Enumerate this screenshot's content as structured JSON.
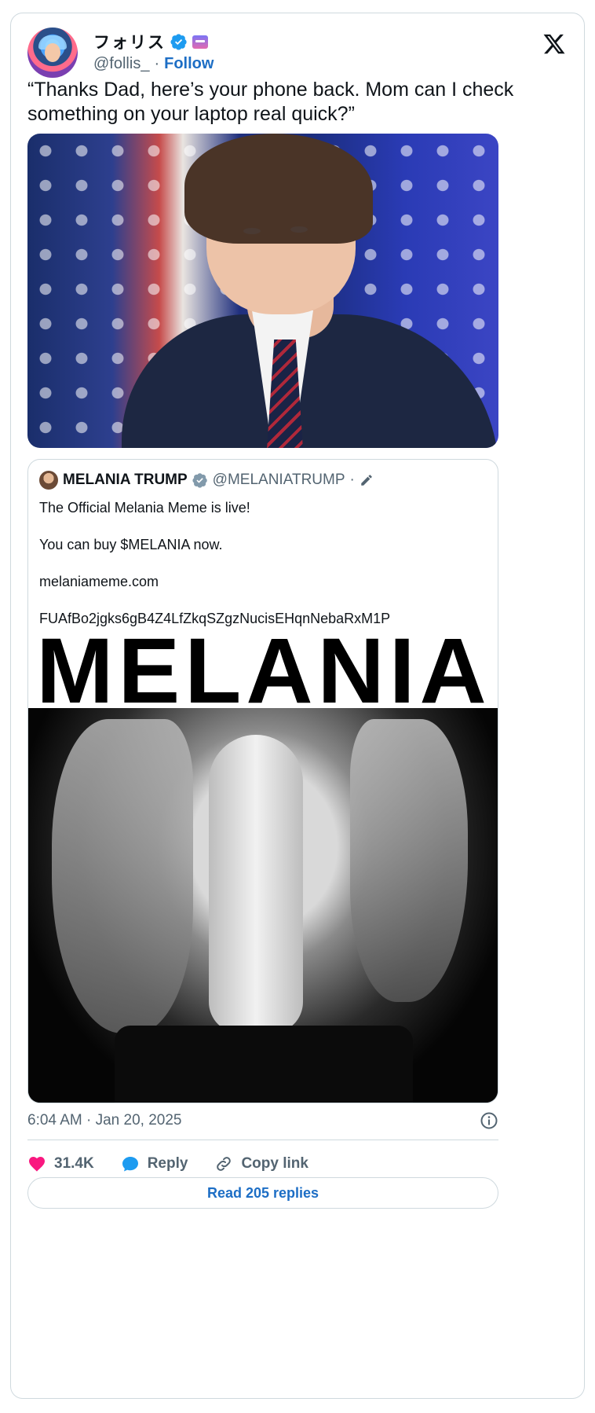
{
  "author": {
    "name": "フォリス",
    "handle": "@follis_",
    "separator": "·",
    "follow_label": "Follow"
  },
  "tweet": {
    "text": "“Thanks Dad, here’s your phone back. Mom can I check something on your laptop real quick?”",
    "timestamp": "6:04 AM · Jan 20, 2025"
  },
  "quoted": {
    "name": "MELANIA TRUMP",
    "handle": "@MELANIATRUMP",
    "separator": "·",
    "lines": [
      "The Official Melania Meme is live!",
      "You can buy $MELANIA now.",
      "melaniameme.com",
      "FUAfBo2jgks6gB4Z4LfZkqSZgzNucisEHqnNebaRxM1P"
    ],
    "image_word": "MELANIA"
  },
  "actions": {
    "likes": "31.4K",
    "reply_label": "Reply",
    "copy_label": "Copy link",
    "read_replies": "Read 205 replies"
  },
  "colors": {
    "accent_blue": "#1d6ec5",
    "verified_blue": "#1d9bf0",
    "like_pink": "#f91880",
    "muted": "#536471",
    "border": "#cfd9de"
  },
  "icons": [
    "verified-badge-icon",
    "affiliate-flag-icon",
    "x-logo-icon",
    "pen-icon",
    "info-icon",
    "heart-icon",
    "reply-bubble-icon",
    "link-icon"
  ]
}
